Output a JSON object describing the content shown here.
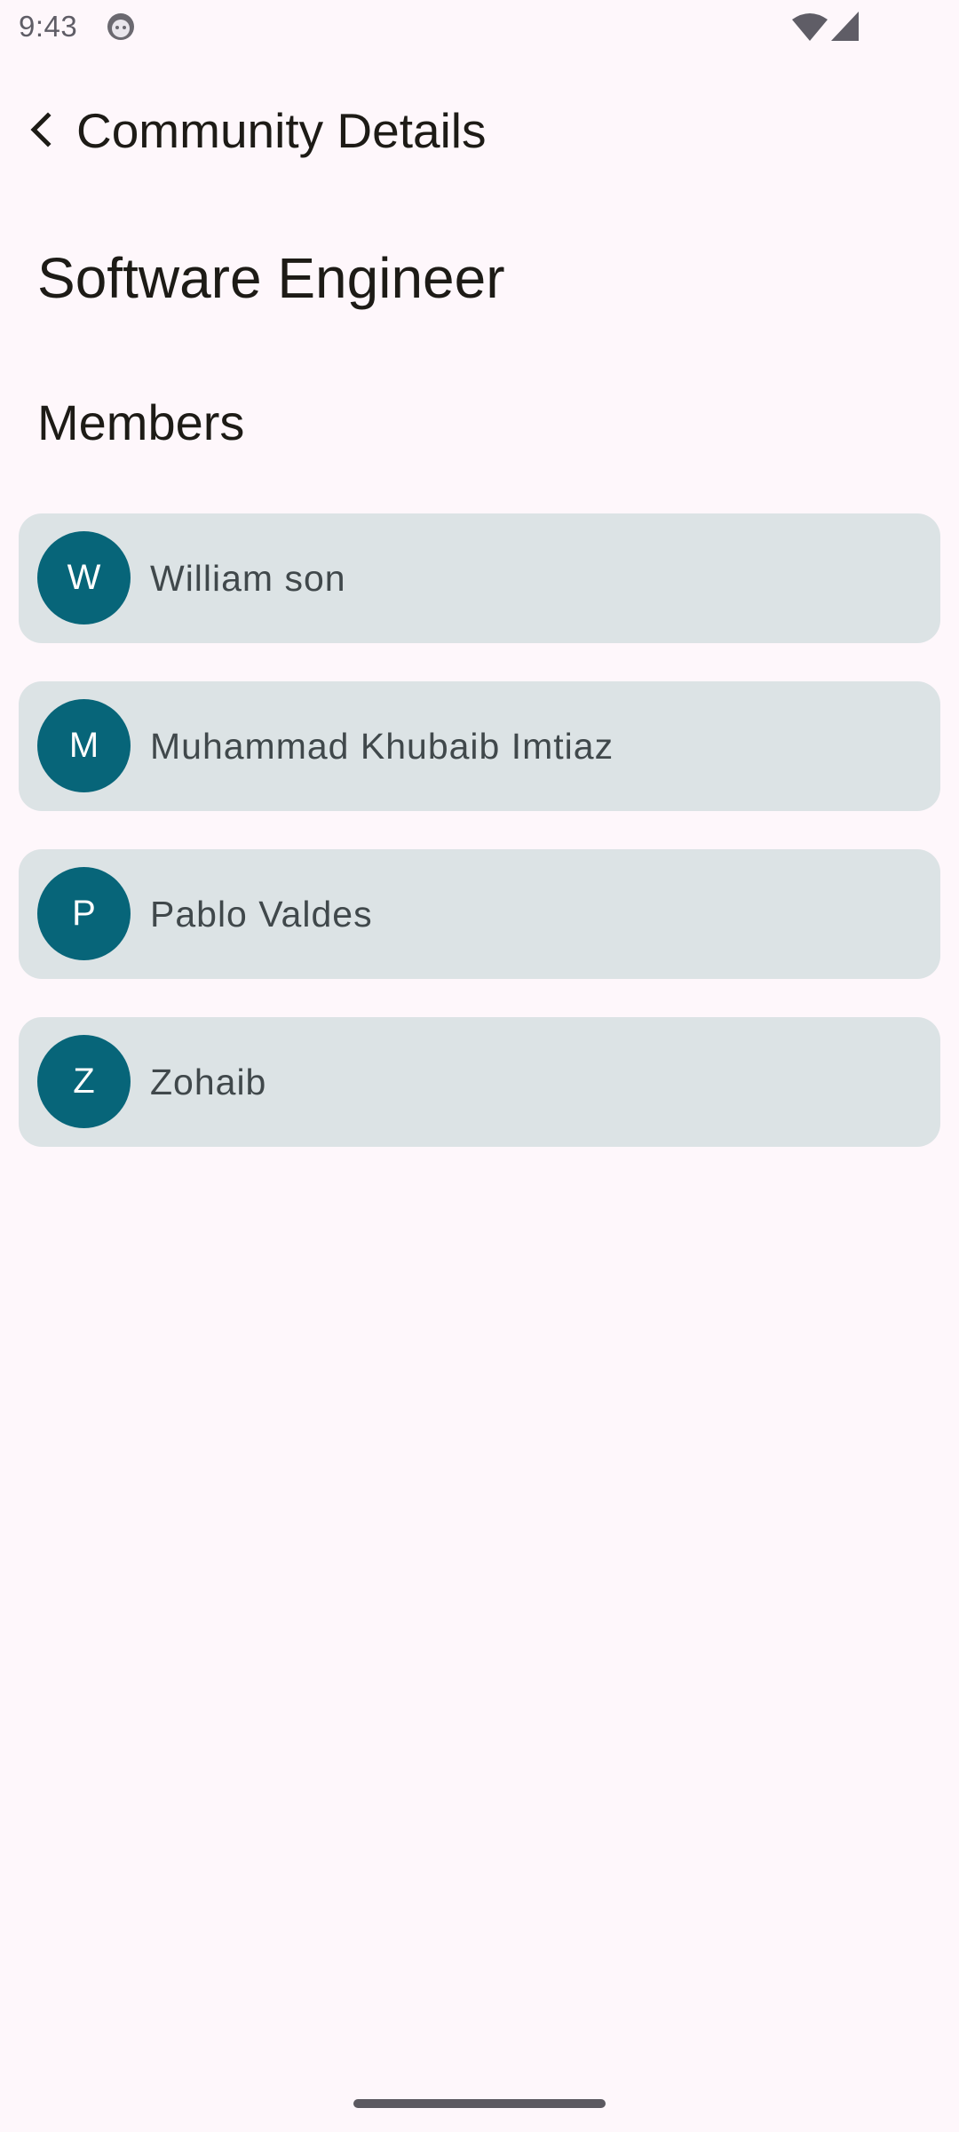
{
  "status_bar": {
    "time": "9:43",
    "icons": [
      "android-face-icon",
      "wifi-icon",
      "cell-signal-icon"
    ]
  },
  "app_bar": {
    "back_icon": "chevron-left-icon",
    "title": "Community Details"
  },
  "community": {
    "name": "Software Engineer",
    "members_heading": "Members"
  },
  "members": [
    {
      "initial": "W",
      "name": "William son"
    },
    {
      "initial": "M",
      "name": "Muhammad Khubaib Imtiaz"
    },
    {
      "initial": "P",
      "name": "Pablo Valdes"
    },
    {
      "initial": "Z",
      "name": "Zohaib"
    }
  ],
  "colors": {
    "background": "#fef7fb",
    "card": "#dce3e5",
    "avatar": "#076579",
    "text_primary": "#1d1b16",
    "text_secondary": "#40484b"
  }
}
